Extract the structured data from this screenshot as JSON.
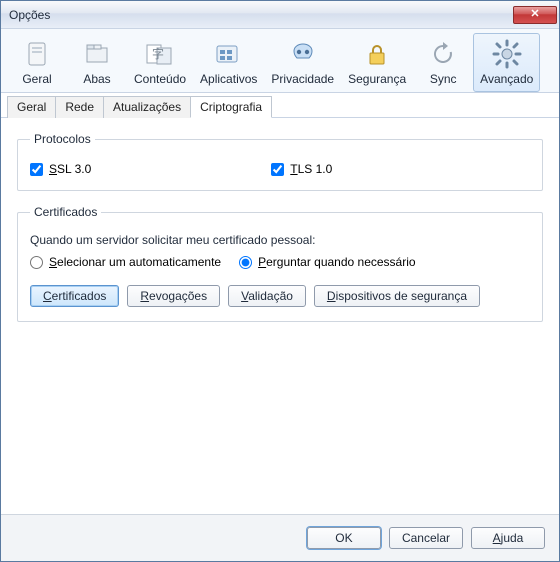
{
  "window": {
    "title": "Opções"
  },
  "toolbar": {
    "items": [
      {
        "label": "Geral"
      },
      {
        "label": "Abas"
      },
      {
        "label": "Conteúdo"
      },
      {
        "label": "Aplicativos"
      },
      {
        "label": "Privacidade"
      },
      {
        "label": "Segurança"
      },
      {
        "label": "Sync"
      },
      {
        "label": "Avançado"
      }
    ]
  },
  "subtabs": {
    "items": [
      {
        "label": "Geral"
      },
      {
        "label": "Rede"
      },
      {
        "label": "Atualizações"
      },
      {
        "label": "Criptografia"
      }
    ]
  },
  "protocols": {
    "legend": "Protocolos",
    "ssl": {
      "letter": "S",
      "rest": "SL 3.0",
      "checked": true
    },
    "tls": {
      "letter": "T",
      "rest": "LS 1.0",
      "checked": true
    }
  },
  "certs": {
    "legend": "Certificados",
    "prompt": "Quando um servidor solicitar meu certificado pessoal:",
    "auto": {
      "letter": "S",
      "rest": "elecionar um automaticamente"
    },
    "ask": {
      "letter": "P",
      "rest": "erguntar quando necessário"
    },
    "selected": "ask",
    "buttons": {
      "certs": {
        "letter": "C",
        "rest": "ertificados"
      },
      "rev": {
        "letter": "R",
        "rest": "evogações"
      },
      "val": {
        "letter": "V",
        "rest": "alidação"
      },
      "dev": {
        "letter": "D",
        "rest": "ispositivos de segurança"
      }
    }
  },
  "footer": {
    "ok": "OK",
    "cancel": "Cancelar",
    "help": {
      "letter": "A",
      "rest": "juda"
    }
  }
}
